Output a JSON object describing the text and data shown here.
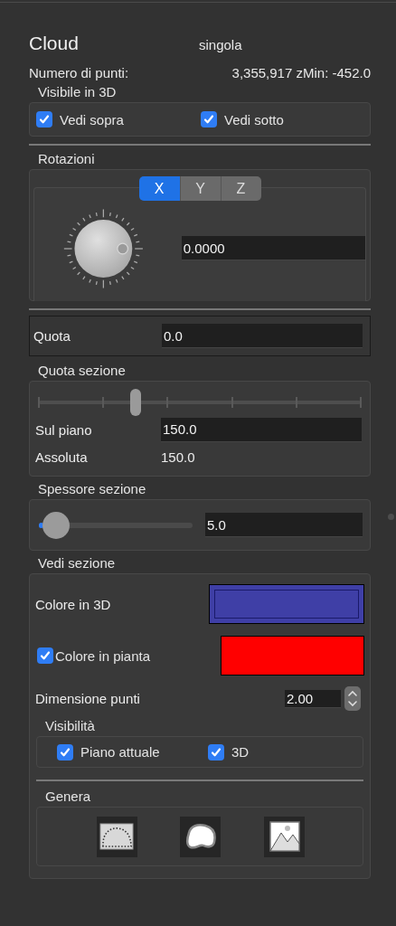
{
  "header": {
    "title": "Cloud",
    "mode": "singola",
    "points_label": "Numero di punti:",
    "points_value": "3,355,917 zMin: -452.0"
  },
  "visible_3d": {
    "title": "Visibile in 3D",
    "options": [
      {
        "label": "Vedi sopra",
        "checked": true
      },
      {
        "label": "Vedi sotto",
        "checked": true
      }
    ]
  },
  "rotations": {
    "title": "Rotazioni",
    "axes": [
      {
        "label": "X",
        "selected": true
      },
      {
        "label": "Y",
        "selected": false
      },
      {
        "label": "Z",
        "selected": false
      }
    ],
    "value": "0.0000"
  },
  "quota": {
    "label": "Quota",
    "value": "0.0"
  },
  "section_height": {
    "title": "Quota sezione",
    "level": 0.3,
    "rows": [
      {
        "kind": "input",
        "label": "Sul piano",
        "value": "150.0"
      },
      {
        "kind": "readout",
        "label": "Assoluta",
        "value": "150.0"
      }
    ]
  },
  "section_thickness": {
    "title": "Spessore sezione",
    "level": 0.03,
    "value": "5.0"
  },
  "view_section": {
    "title": "Vedi sezione",
    "color_3d": {
      "label": "Colore in 3D",
      "color": "#3f3fa6"
    },
    "color_plan": {
      "label": "Colore in pianta",
      "checked": true,
      "color": "#ff0000"
    },
    "point_size": {
      "label": "Dimensione punti",
      "value": "2.00"
    },
    "visibility": {
      "title": "Visibilità",
      "options": [
        {
          "label": "Piano attuale",
          "checked": true
        },
        {
          "label": "3D",
          "checked": true
        }
      ]
    },
    "generate": {
      "title": "Genera"
    }
  }
}
